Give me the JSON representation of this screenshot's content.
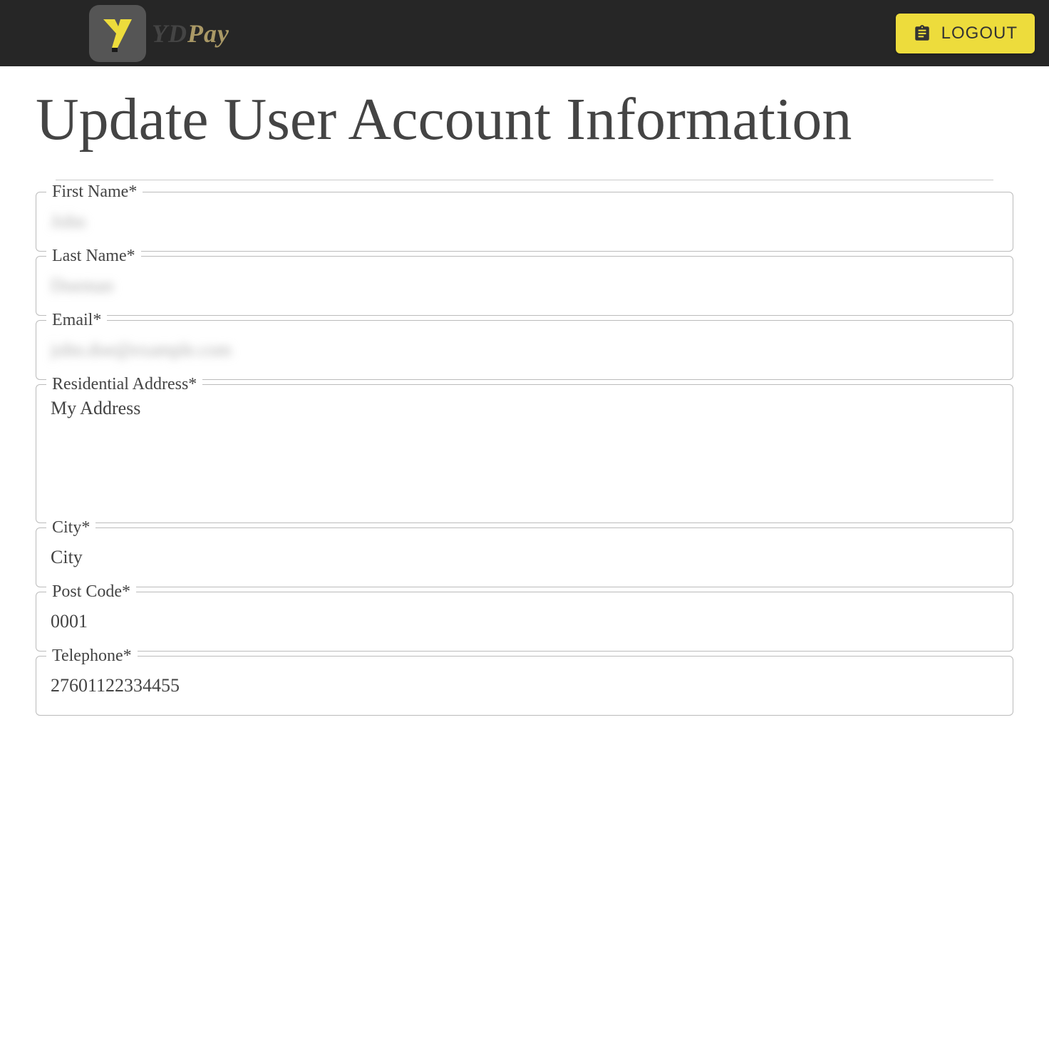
{
  "header": {
    "brand_name": "YDPay",
    "logout_label": "LOGOUT"
  },
  "page": {
    "title": "Update User Account Information"
  },
  "form": {
    "first_name": {
      "label": "First Name*",
      "value": "John"
    },
    "last_name": {
      "label": "Last Name*",
      "value": "Doeman"
    },
    "email": {
      "label": "Email*",
      "value": "john.doe@example.com"
    },
    "residential_address": {
      "label": "Residential Address*",
      "value": "My Address"
    },
    "city": {
      "label": "City*",
      "value": "City"
    },
    "post_code": {
      "label": "Post Code*",
      "value": "0001"
    },
    "telephone": {
      "label": "Telephone*",
      "value": "27601122334455"
    }
  }
}
